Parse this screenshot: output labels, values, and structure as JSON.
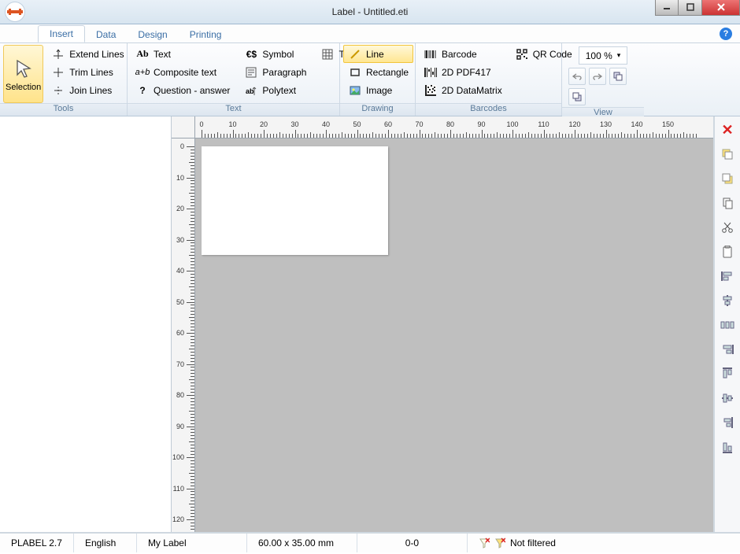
{
  "window": {
    "title": "Label - Untitled.eti"
  },
  "tabs": {
    "insert": "Insert",
    "data": "Data",
    "design": "Design",
    "printing": "Printing",
    "active": "insert"
  },
  "ribbon": {
    "tools": {
      "label": "Tools",
      "selection": "Selection",
      "extend": "Extend Lines",
      "trim": "Trim Lines",
      "join": "Join Lines"
    },
    "text": {
      "label": "Text",
      "text": "Text",
      "composite": "Composite text",
      "question": "Question - answer",
      "symbol": "Symbol",
      "paragraph": "Paragraph",
      "polytext": "Polytext",
      "table": "Table"
    },
    "drawing": {
      "label": "Drawing",
      "line": "Line",
      "rectangle": "Rectangle",
      "image": "Image"
    },
    "barcodes": {
      "label": "Barcodes",
      "barcode": "Barcode",
      "pdf417": "2D PDF417",
      "datamatrix": "2D DataMatrix",
      "qr": "QR Code"
    },
    "view": {
      "label": "View",
      "zoom": "100 %"
    }
  },
  "ruler": {
    "h_majors": [
      0,
      10,
      20,
      30,
      40,
      50,
      60,
      70,
      80,
      90,
      100,
      110,
      120,
      130,
      140,
      150
    ],
    "v_majors": [
      0,
      10,
      20,
      30,
      40,
      50,
      60,
      70,
      80,
      90,
      100,
      110,
      120
    ]
  },
  "label_doc": {
    "width_mm": 60.0,
    "height_mm": 35.0
  },
  "status": {
    "app": "PLABEL 2.7",
    "lang": "English",
    "doc": "My Label",
    "size": "60.00 x 35.00 mm",
    "cursor": "0-0",
    "filter": "Not filtered"
  }
}
